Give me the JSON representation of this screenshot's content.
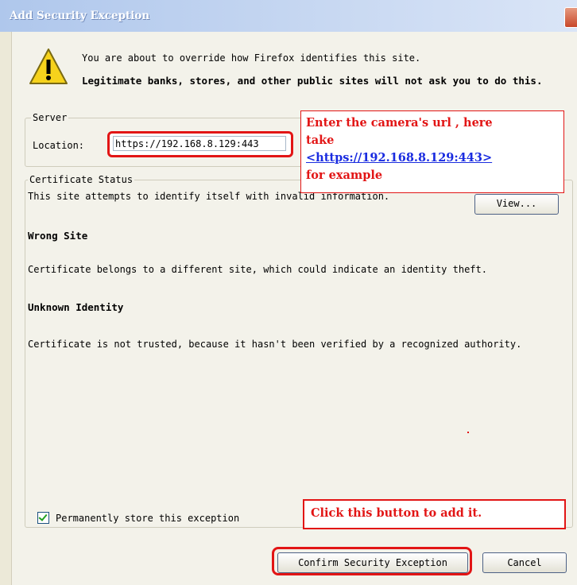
{
  "window": {
    "title": "Add Security Exception"
  },
  "intro": "You are about to override how Firefox identifies this site.",
  "warning": "Legitimate banks, stores, and other public sites will not ask you to do this.",
  "server": {
    "legend": "Server",
    "location_label": "Location:",
    "location_value": "https://192.168.8.129:443"
  },
  "annotation_url": {
    "line1": "Enter the camera's url , here",
    "line2": "take",
    "link": "<https://192.168.8.129:443>",
    "line4": "for example"
  },
  "certificate": {
    "legend": "Certificate Status",
    "summary": "This site attempts to identify itself with invalid information.",
    "view_button": "View...",
    "wrong_site_heading": "Wrong Site",
    "wrong_site_text": "Certificate belongs to a different site, which could indicate an identity theft.",
    "unknown_heading": "Unknown Identity",
    "unknown_text": "Certificate is not trusted, because it hasn't been verified by a recognized authority."
  },
  "permanent": {
    "label": "Permanently store this exception",
    "checked": true
  },
  "annotation_button": "Click this button to add it.",
  "buttons": {
    "confirm": "Confirm Security Exception",
    "cancel": "Cancel"
  },
  "colors": {
    "annotation_red": "#E21515",
    "link_blue": "#1A2CE0"
  },
  "icons": [
    "warning-icon",
    "close-icon",
    "checkmark-icon"
  ]
}
